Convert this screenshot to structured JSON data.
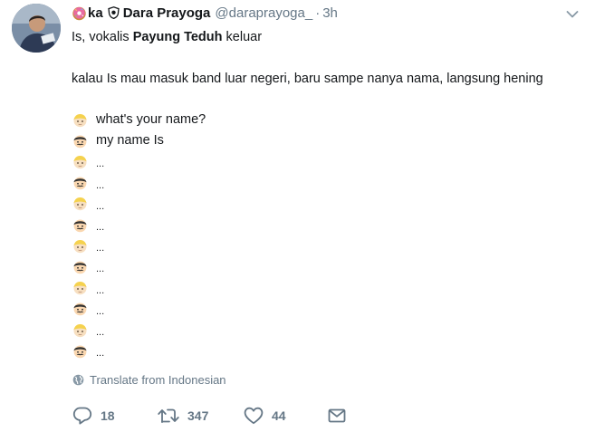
{
  "tweet": {
    "display_name_prefix": "ka",
    "display_name": "Dara Prayoga",
    "handle": "@daraprayoga_",
    "separator": "·",
    "time": "3h",
    "line1_pre": "Is, vokalis ",
    "line1_bold": "Payung Teduh",
    "line1_post": " keluar",
    "line2": "kalau Is mau masuk band luar negeri, baru sampe nanya nama, langsung hening",
    "dialog": [
      {
        "speaker": "blond-person-emoji",
        "text": "what's your name?"
      },
      {
        "speaker": "mustache-man-emoji",
        "text": "my name Is"
      },
      {
        "speaker": "blond-person-emoji",
        "text": "..."
      },
      {
        "speaker": "mustache-man-emoji",
        "text": "..."
      },
      {
        "speaker": "blond-person-emoji",
        "text": "..."
      },
      {
        "speaker": "mustache-man-emoji",
        "text": "..."
      },
      {
        "speaker": "blond-person-emoji",
        "text": "..."
      },
      {
        "speaker": "mustache-man-emoji",
        "text": "..."
      },
      {
        "speaker": "blond-person-emoji",
        "text": "..."
      },
      {
        "speaker": "mustache-man-emoji",
        "text": "..."
      },
      {
        "speaker": "blond-person-emoji",
        "text": "..."
      },
      {
        "speaker": "mustache-man-emoji",
        "text": "..."
      }
    ],
    "translate": "Translate from Indonesian",
    "actions": {
      "replies": "18",
      "retweets": "347",
      "likes": "44"
    },
    "icons": {
      "avatar": "user-avatar",
      "donut": "donut-icon",
      "shield": "shield-icon",
      "caret": "chevron-down-icon",
      "globe": "globe-icon",
      "reply": "reply-icon",
      "retweet": "retweet-icon",
      "like": "heart-icon",
      "message": "envelope-icon"
    },
    "colors": {
      "text": "#14171a",
      "secondary": "#657786"
    }
  }
}
